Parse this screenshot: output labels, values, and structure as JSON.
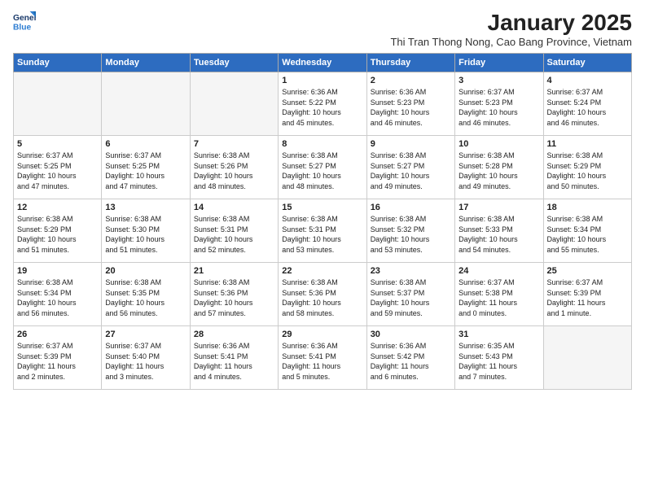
{
  "logo": {
    "line1": "General",
    "line2": "Blue"
  },
  "title": "January 2025",
  "subtitle": "Thi Tran Thong Nong, Cao Bang Province, Vietnam",
  "days_of_week": [
    "Sunday",
    "Monday",
    "Tuesday",
    "Wednesday",
    "Thursday",
    "Friday",
    "Saturday"
  ],
  "weeks": [
    [
      {
        "day": "",
        "info": ""
      },
      {
        "day": "",
        "info": ""
      },
      {
        "day": "",
        "info": ""
      },
      {
        "day": "1",
        "info": "Sunrise: 6:36 AM\nSunset: 5:22 PM\nDaylight: 10 hours\nand 45 minutes."
      },
      {
        "day": "2",
        "info": "Sunrise: 6:36 AM\nSunset: 5:23 PM\nDaylight: 10 hours\nand 46 minutes."
      },
      {
        "day": "3",
        "info": "Sunrise: 6:37 AM\nSunset: 5:23 PM\nDaylight: 10 hours\nand 46 minutes."
      },
      {
        "day": "4",
        "info": "Sunrise: 6:37 AM\nSunset: 5:24 PM\nDaylight: 10 hours\nand 46 minutes."
      }
    ],
    [
      {
        "day": "5",
        "info": "Sunrise: 6:37 AM\nSunset: 5:25 PM\nDaylight: 10 hours\nand 47 minutes."
      },
      {
        "day": "6",
        "info": "Sunrise: 6:37 AM\nSunset: 5:25 PM\nDaylight: 10 hours\nand 47 minutes."
      },
      {
        "day": "7",
        "info": "Sunrise: 6:38 AM\nSunset: 5:26 PM\nDaylight: 10 hours\nand 48 minutes."
      },
      {
        "day": "8",
        "info": "Sunrise: 6:38 AM\nSunset: 5:27 PM\nDaylight: 10 hours\nand 48 minutes."
      },
      {
        "day": "9",
        "info": "Sunrise: 6:38 AM\nSunset: 5:27 PM\nDaylight: 10 hours\nand 49 minutes."
      },
      {
        "day": "10",
        "info": "Sunrise: 6:38 AM\nSunset: 5:28 PM\nDaylight: 10 hours\nand 49 minutes."
      },
      {
        "day": "11",
        "info": "Sunrise: 6:38 AM\nSunset: 5:29 PM\nDaylight: 10 hours\nand 50 minutes."
      }
    ],
    [
      {
        "day": "12",
        "info": "Sunrise: 6:38 AM\nSunset: 5:29 PM\nDaylight: 10 hours\nand 51 minutes."
      },
      {
        "day": "13",
        "info": "Sunrise: 6:38 AM\nSunset: 5:30 PM\nDaylight: 10 hours\nand 51 minutes."
      },
      {
        "day": "14",
        "info": "Sunrise: 6:38 AM\nSunset: 5:31 PM\nDaylight: 10 hours\nand 52 minutes."
      },
      {
        "day": "15",
        "info": "Sunrise: 6:38 AM\nSunset: 5:31 PM\nDaylight: 10 hours\nand 53 minutes."
      },
      {
        "day": "16",
        "info": "Sunrise: 6:38 AM\nSunset: 5:32 PM\nDaylight: 10 hours\nand 53 minutes."
      },
      {
        "day": "17",
        "info": "Sunrise: 6:38 AM\nSunset: 5:33 PM\nDaylight: 10 hours\nand 54 minutes."
      },
      {
        "day": "18",
        "info": "Sunrise: 6:38 AM\nSunset: 5:34 PM\nDaylight: 10 hours\nand 55 minutes."
      }
    ],
    [
      {
        "day": "19",
        "info": "Sunrise: 6:38 AM\nSunset: 5:34 PM\nDaylight: 10 hours\nand 56 minutes."
      },
      {
        "day": "20",
        "info": "Sunrise: 6:38 AM\nSunset: 5:35 PM\nDaylight: 10 hours\nand 56 minutes."
      },
      {
        "day": "21",
        "info": "Sunrise: 6:38 AM\nSunset: 5:36 PM\nDaylight: 10 hours\nand 57 minutes."
      },
      {
        "day": "22",
        "info": "Sunrise: 6:38 AM\nSunset: 5:36 PM\nDaylight: 10 hours\nand 58 minutes."
      },
      {
        "day": "23",
        "info": "Sunrise: 6:38 AM\nSunset: 5:37 PM\nDaylight: 10 hours\nand 59 minutes."
      },
      {
        "day": "24",
        "info": "Sunrise: 6:37 AM\nSunset: 5:38 PM\nDaylight: 11 hours\nand 0 minutes."
      },
      {
        "day": "25",
        "info": "Sunrise: 6:37 AM\nSunset: 5:39 PM\nDaylight: 11 hours\nand 1 minute."
      }
    ],
    [
      {
        "day": "26",
        "info": "Sunrise: 6:37 AM\nSunset: 5:39 PM\nDaylight: 11 hours\nand 2 minutes."
      },
      {
        "day": "27",
        "info": "Sunrise: 6:37 AM\nSunset: 5:40 PM\nDaylight: 11 hours\nand 3 minutes."
      },
      {
        "day": "28",
        "info": "Sunrise: 6:36 AM\nSunset: 5:41 PM\nDaylight: 11 hours\nand 4 minutes."
      },
      {
        "day": "29",
        "info": "Sunrise: 6:36 AM\nSunset: 5:41 PM\nDaylight: 11 hours\nand 5 minutes."
      },
      {
        "day": "30",
        "info": "Sunrise: 6:36 AM\nSunset: 5:42 PM\nDaylight: 11 hours\nand 6 minutes."
      },
      {
        "day": "31",
        "info": "Sunrise: 6:35 AM\nSunset: 5:43 PM\nDaylight: 11 hours\nand 7 minutes."
      },
      {
        "day": "",
        "info": ""
      }
    ]
  ]
}
